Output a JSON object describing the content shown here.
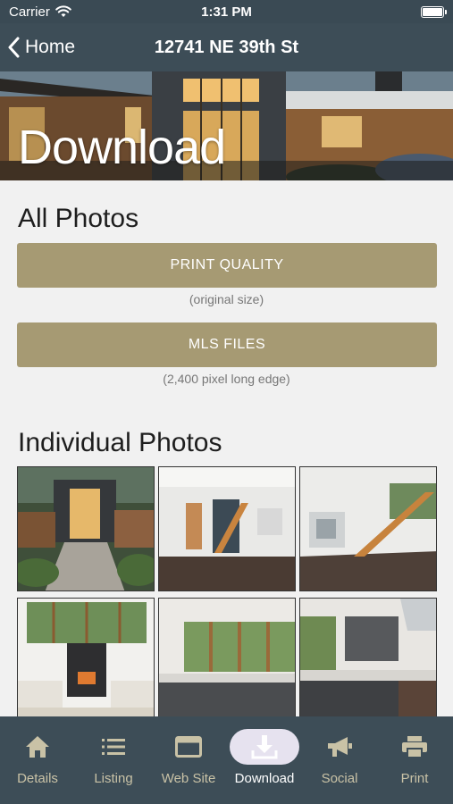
{
  "status_bar": {
    "carrier": "Carrier",
    "time": "1:31 PM"
  },
  "nav": {
    "back_label": "Home",
    "title": "12741 NE 39th St"
  },
  "hero": {
    "title": "Download"
  },
  "all_photos": {
    "title": "All Photos",
    "print_quality_label": "PRINT QUALITY",
    "print_quality_caption": "(original size)",
    "mls_files_label": "MLS FILES",
    "mls_files_caption": "(2,400 pixel long edge)"
  },
  "individual_photos": {
    "title": "Individual Photos"
  },
  "tabs": [
    {
      "label": "Details",
      "icon": "home-icon"
    },
    {
      "label": "Listing",
      "icon": "list-icon"
    },
    {
      "label": "Web Site",
      "icon": "browser-icon"
    },
    {
      "label": "Download",
      "icon": "download-icon",
      "active": true
    },
    {
      "label": "Social",
      "icon": "megaphone-icon"
    },
    {
      "label": "Print",
      "icon": "printer-icon"
    }
  ],
  "colors": {
    "bar": "#3d4d57",
    "accent_gold": "#a69a73",
    "tab_label": "#c9c2a6",
    "active_pill": "#e6e2ef"
  }
}
